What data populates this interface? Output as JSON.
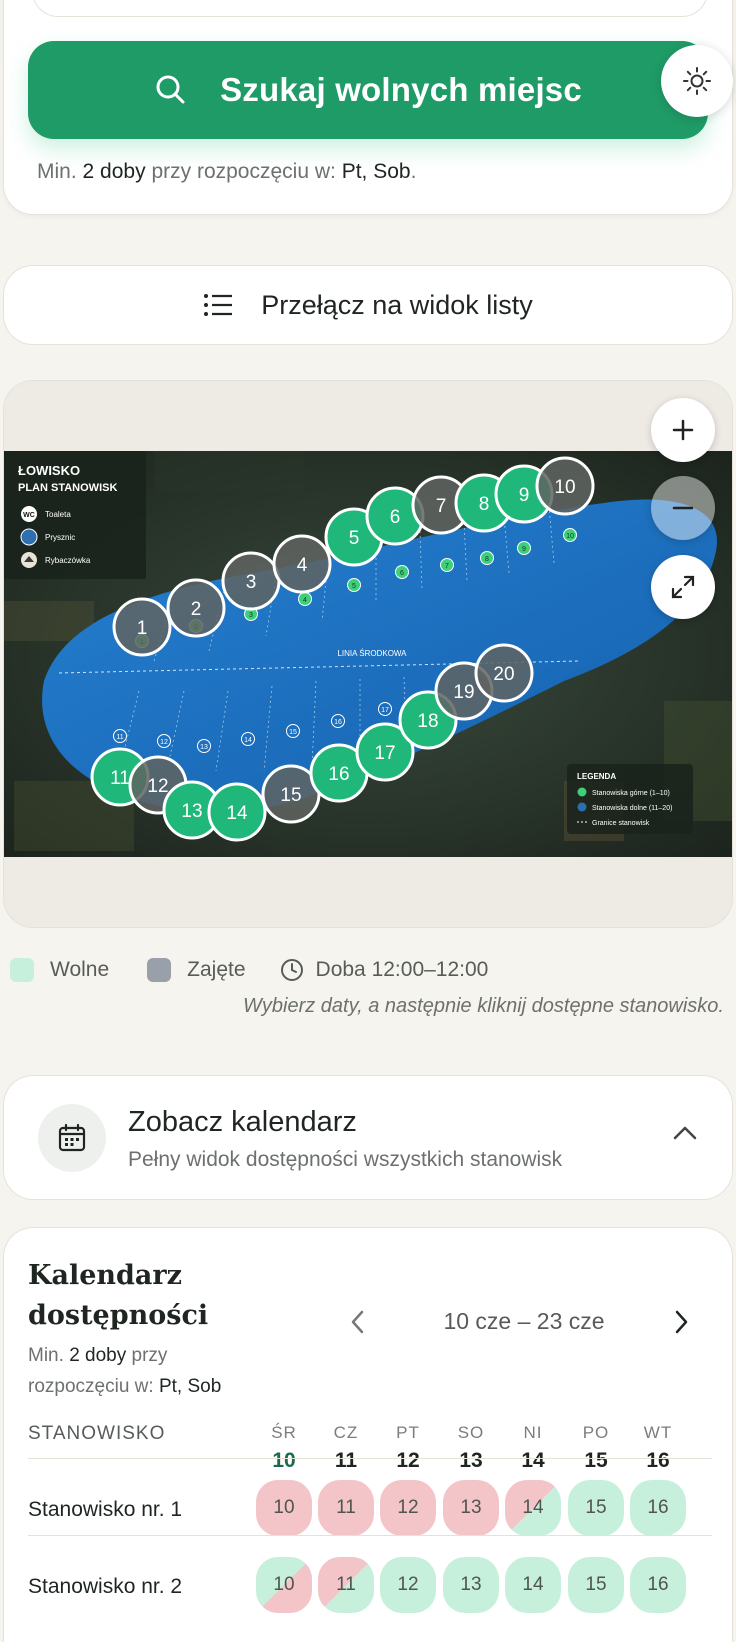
{
  "search": {
    "button_label": "Szukaj wolnych miejsc",
    "min_note_prefix": "Min.",
    "min_note_nights": "2 doby",
    "min_note_mid": "przy rozpoczęciu w:",
    "min_note_days": "Pt, Sob",
    "min_note_end": "."
  },
  "view_toggle": {
    "label": "Przełącz na widok listy"
  },
  "map": {
    "title_line1": "ŁOWISKO",
    "title_line2": "PLAN STANOWISK",
    "poi": [
      {
        "badge": "WC",
        "label": "Toaleta"
      },
      {
        "badge": "",
        "label": "Prysznic"
      },
      {
        "badge": "",
        "label": "Rybaczówka"
      }
    ],
    "centerline_label": "LINIA ŚRODKOWA",
    "legend_title": "LEGENDA",
    "legend_items": [
      {
        "label": "Stanowiska górne (1–10)",
        "color": "#3ecf7a"
      },
      {
        "label": "Stanowiska dolne (11–20)",
        "color": "#2a6fae"
      },
      {
        "label": "Granice stanowisk",
        "color": "#ffffff"
      }
    ],
    "spots": [
      {
        "n": "1",
        "status": "busy"
      },
      {
        "n": "2",
        "status": "busy"
      },
      {
        "n": "3",
        "status": "busy"
      },
      {
        "n": "4",
        "status": "busy"
      },
      {
        "n": "5",
        "status": "free"
      },
      {
        "n": "6",
        "status": "free"
      },
      {
        "n": "7",
        "status": "busy"
      },
      {
        "n": "8",
        "status": "free"
      },
      {
        "n": "9",
        "status": "free"
      },
      {
        "n": "10",
        "status": "busy"
      },
      {
        "n": "11",
        "status": "free"
      },
      {
        "n": "12",
        "status": "busy"
      },
      {
        "n": "13",
        "status": "free"
      },
      {
        "n": "14",
        "status": "free"
      },
      {
        "n": "15",
        "status": "busy"
      },
      {
        "n": "16",
        "status": "free"
      },
      {
        "n": "17",
        "status": "free"
      },
      {
        "n": "18",
        "status": "free"
      },
      {
        "n": "19",
        "status": "busy"
      },
      {
        "n": "20",
        "status": "busy"
      }
    ],
    "colors": {
      "free": "#1fb87a",
      "busy": "#5f6461",
      "water": "#1e6fc0"
    }
  },
  "legend": {
    "free_label": "Wolne",
    "busy_label": "Zajęte",
    "hours_label": "Doba 12:00–12:00",
    "hint": "Wybierz daty, a następnie kliknij dostępne stanowisko."
  },
  "calendar_toggle": {
    "title": "Zobacz kalendarz",
    "subtitle": "Pełny widok dostępności wszystkich stanowisk"
  },
  "calendar": {
    "heading_line1": "Kalendarz",
    "heading_line2": "dostępności",
    "note_prefix": "Min.",
    "note_nights": "2 doby",
    "note_mid": "przy rozpoczęciu w:",
    "note_days": "Pt, Sob",
    "range": "10 cze – 23 cze",
    "column_header": "STANOWISKO",
    "days": [
      {
        "name": "ŚR",
        "num": "10"
      },
      {
        "name": "CZ",
        "num": "11"
      },
      {
        "name": "PT",
        "num": "12"
      },
      {
        "name": "SO",
        "num": "13"
      },
      {
        "name": "NI",
        "num": "14"
      },
      {
        "name": "PO",
        "num": "15"
      },
      {
        "name": "WT",
        "num": "16"
      }
    ],
    "rows": [
      {
        "label": "Stanowisko nr. 1",
        "cells": [
          {
            "d": "10",
            "s": "busy"
          },
          {
            "d": "11",
            "s": "busy"
          },
          {
            "d": "12",
            "s": "busy"
          },
          {
            "d": "13",
            "s": "busy"
          },
          {
            "d": "14",
            "s": "busy-free"
          },
          {
            "d": "15",
            "s": "free"
          },
          {
            "d": "16",
            "s": "free"
          }
        ]
      },
      {
        "label": "Stanowisko nr. 2",
        "cells": [
          {
            "d": "10",
            "s": "free-busy"
          },
          {
            "d": "11",
            "s": "busy-free"
          },
          {
            "d": "12",
            "s": "free"
          },
          {
            "d": "13",
            "s": "free"
          },
          {
            "d": "14",
            "s": "free"
          },
          {
            "d": "15",
            "s": "free"
          },
          {
            "d": "16",
            "s": "free"
          }
        ]
      }
    ]
  }
}
